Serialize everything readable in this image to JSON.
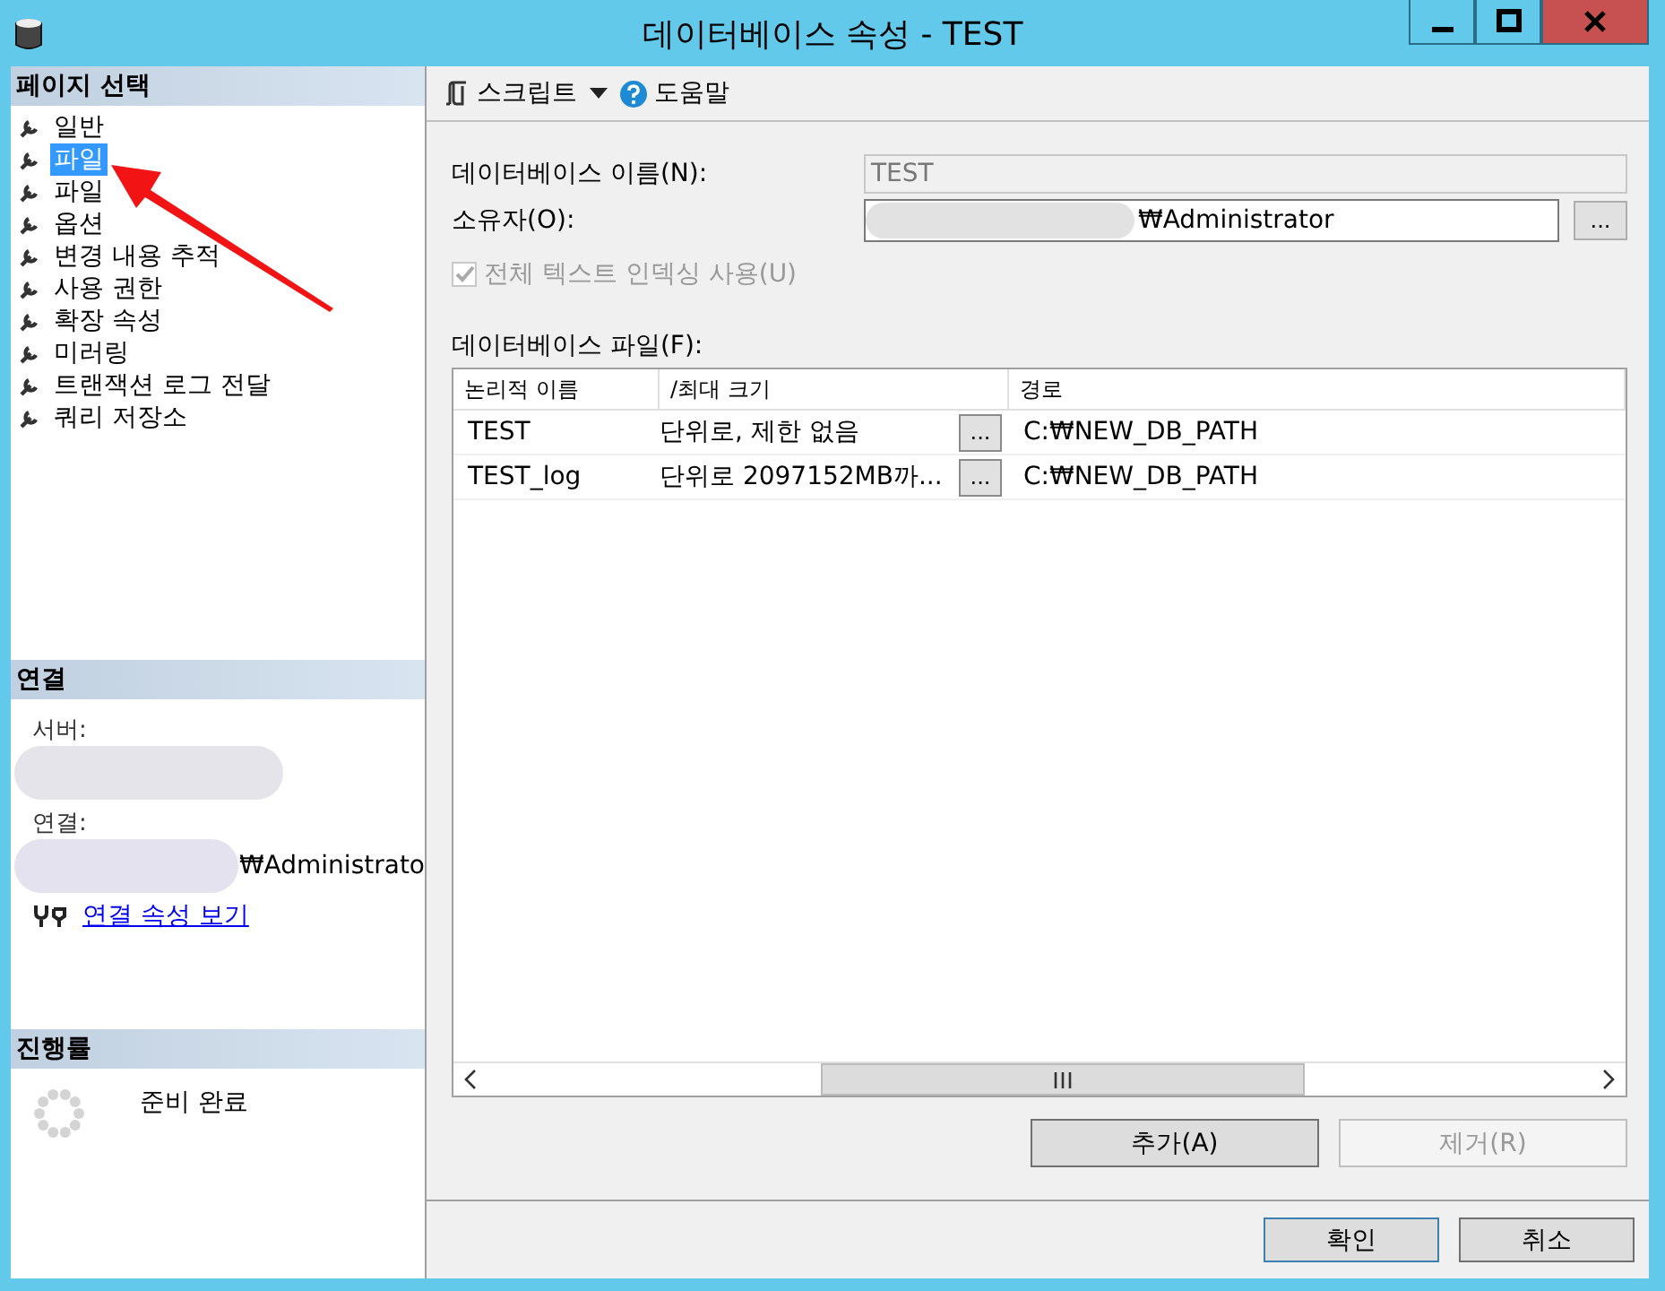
{
  "window": {
    "title": "데이터베이스 속성 - TEST"
  },
  "sidebar": {
    "header": "페이지 선택",
    "items": [
      {
        "label": "일반",
        "selected": false
      },
      {
        "label": "파일",
        "selected": true
      },
      {
        "label": "파일",
        "selected": false
      },
      {
        "label": "옵션",
        "selected": false
      },
      {
        "label": "변경 내용 추적",
        "selected": false
      },
      {
        "label": "사용 권한",
        "selected": false
      },
      {
        "label": "확장 속성",
        "selected": false
      },
      {
        "label": "미러링",
        "selected": false
      },
      {
        "label": "트랜잭션 로그 전달",
        "selected": false
      },
      {
        "label": "쿼리 저장소",
        "selected": false
      }
    ]
  },
  "connection": {
    "header": "연결",
    "server_label": "서버:",
    "connection_label": "연결:",
    "connection_value": "₩Administrato",
    "link": "연결 속성 보기"
  },
  "progress": {
    "header": "진행률",
    "status": "준비 완료"
  },
  "toolbar": {
    "script": "스크립트",
    "help": "도움말"
  },
  "form": {
    "db_name_label": "데이터베이스 이름(N):",
    "db_name": "TEST",
    "owner_label": "소유자(O):",
    "owner": "₩Administrator",
    "owner_button": "...",
    "fulltext": {
      "label": "전체 텍스트 인덱싱 사용(U)",
      "checked": true,
      "disabled": true
    }
  },
  "files": {
    "label": "데이터베이스 파일(F):",
    "columns": [
      "논리적 이름",
      "/최대 크기",
      "경로"
    ],
    "rows": [
      {
        "name": "TEST",
        "size": "단위로, 제한 없음",
        "button": "...",
        "path": "C:₩NEW_DB_PATH"
      },
      {
        "name": "TEST_log",
        "size": "단위로 2097152MB까...",
        "button": "...",
        "path": "C:₩NEW_DB_PATH"
      }
    ]
  },
  "file_buttons": [
    {
      "label": "추가(A)",
      "disabled": false
    },
    {
      "label": "제거(R)",
      "disabled": true
    }
  ],
  "dialog_buttons": [
    {
      "label": "확인"
    },
    {
      "label": "취소"
    }
  ]
}
